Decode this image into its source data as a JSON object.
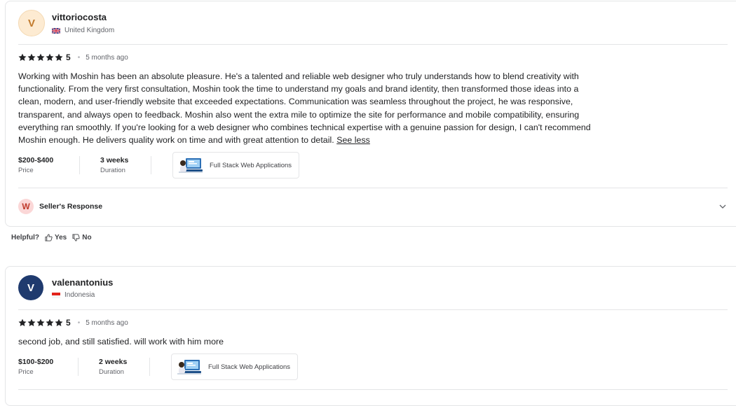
{
  "reviews": [
    {
      "avatar_letter": "V",
      "avatar_bg": "#fdebd2",
      "avatar_color": "#c17a2c",
      "username": "vittoriocosta",
      "country": "United Kingdom",
      "rating": "5",
      "time_ago": "5 months ago",
      "text": "Working with Moshin has been an absolute pleasure. He's a talented and reliable web designer who truly understands how to blend creativity with functionality. From the very first consultation, Moshin took the time to understand my goals and brand identity, then transformed those ideas into a clean, modern, and user-friendly website that exceeded expectations. Communication was seamless throughout the project, he was responsive, transparent, and always open to feedback. Moshin also went the extra mile to optimize the site for performance and mobile compatibility, ensuring everything ran smoothly. If you're looking for a web designer who combines technical expertise with a genuine passion for design, I can't recommend Moshin enough. He delivers quality work on time and with great attention to detail.",
      "see_less": "See less",
      "price": "$200-$400",
      "price_label": "Price",
      "duration": "3 weeks",
      "duration_label": "Duration",
      "gig_title": "Full Stack Web Applications",
      "seller_response_letter": "W",
      "seller_response_label": "Seller's Response"
    },
    {
      "avatar_letter": "V",
      "avatar_bg": "#1f3a6e",
      "avatar_color": "#ffffff",
      "username": "valenantonius",
      "country": "Indonesia",
      "rating": "5",
      "time_ago": "5 months ago",
      "text": "second job, and still satisfied. will work with him more",
      "price": "$100-$200",
      "price_label": "Price",
      "duration": "2 weeks",
      "duration_label": "Duration",
      "gig_title": "Full Stack Web Applications"
    }
  ],
  "helpful": {
    "label": "Helpful?",
    "yes": "Yes",
    "no": "No"
  },
  "colors": {
    "star": "#222325",
    "border": "#e4e5e7"
  }
}
